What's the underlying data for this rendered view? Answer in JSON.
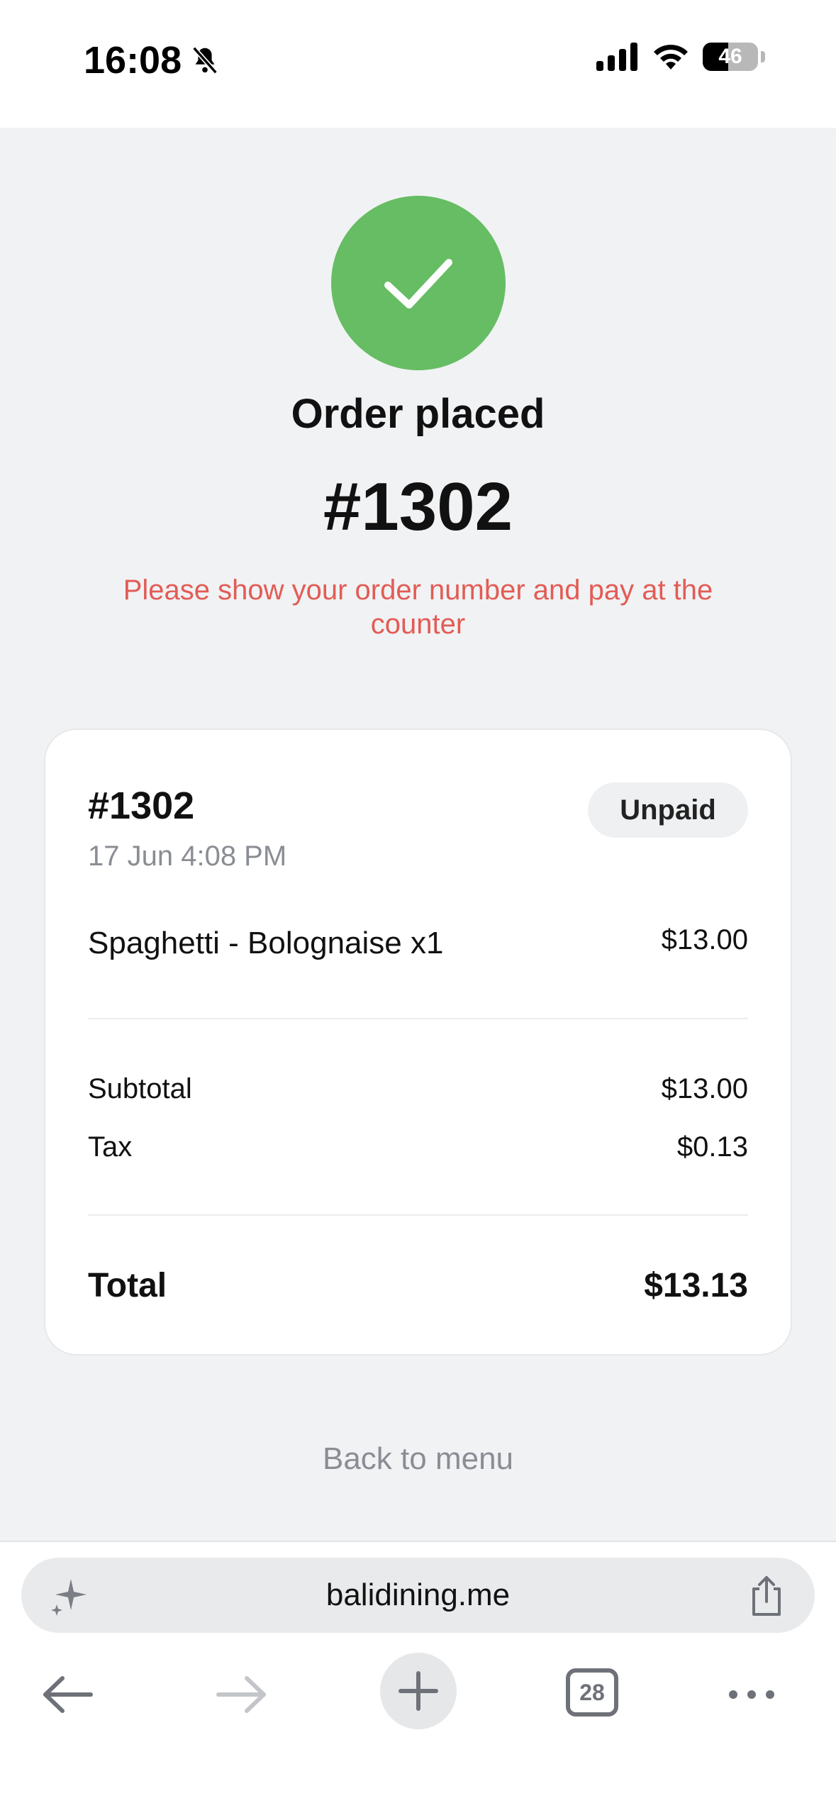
{
  "status_bar": {
    "time": "16:08",
    "battery": "46"
  },
  "confirmation": {
    "title": "Order placed",
    "order_number": "#1302",
    "notice": "Please show your order number and pay at the counter"
  },
  "order_card": {
    "order_number": "#1302",
    "date": "17 Jun 4:08 PM",
    "status": "Unpaid",
    "items": [
      {
        "name": "Spaghetti - Bolognaise x1",
        "price": "$13.00"
      }
    ],
    "subtotal_label": "Subtotal",
    "subtotal": "$13.00",
    "tax_label": "Tax",
    "tax": "$0.13",
    "total_label": "Total",
    "total": "$13.13"
  },
  "back_link": "Back to menu",
  "browser": {
    "url": "balidining.me",
    "tab_count": "28"
  },
  "colors": {
    "success": "#66bd63",
    "notice": "#e25c55",
    "muted": "#8a8d93"
  },
  "icons": [
    "bell-slash-icon",
    "signal-icon",
    "wifi-icon",
    "battery-icon",
    "check-icon",
    "sparkle-icon",
    "share-icon",
    "back-arrow-icon",
    "forward-arrow-icon",
    "plus-icon",
    "tabs-icon",
    "more-icon"
  ]
}
